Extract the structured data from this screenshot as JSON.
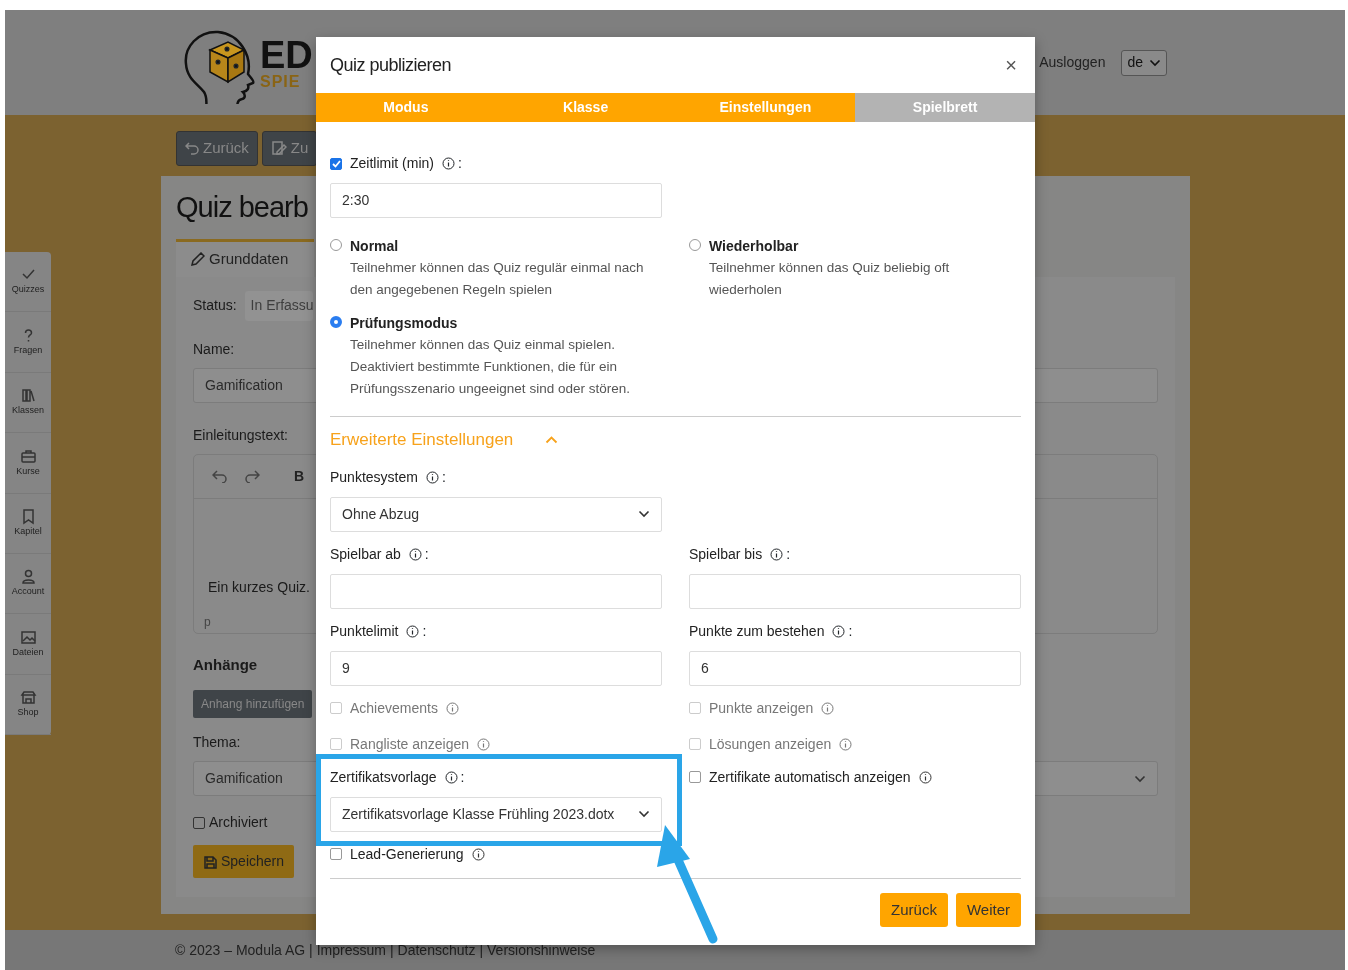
{
  "header": {
    "logo_text": "ED",
    "logo_subtext": "SPIE",
    "links": [
      "Ausloggen"
    ],
    "language": "de"
  },
  "sidebar": {
    "items": [
      {
        "label": "Quizzes"
      },
      {
        "label": "Fragen"
      },
      {
        "label": "Klassen"
      },
      {
        "label": "Kurse"
      },
      {
        "label": "Kapitel"
      },
      {
        "label": "Account"
      },
      {
        "label": "Dateien"
      },
      {
        "label": "Shop"
      }
    ]
  },
  "toolbar": [
    {
      "label": "Zurück"
    },
    {
      "label": "Zu"
    }
  ],
  "page": {
    "title": "Quiz bearb",
    "tab": "Grunddaten",
    "status_label": "Status:",
    "status_value": "In Erfassu",
    "name_label": "Name:",
    "name_value": "Gamification",
    "intro_label": "Einleitungstext:",
    "editor_bold": "B",
    "editor_text": "Ein kurzes Quiz.",
    "editor_path": "p",
    "attachments_heading": "Anhänge",
    "attach_button": "Anhang hinzufügen",
    "theme_label": "Thema:",
    "theme_value": "Gamification",
    "archived": {
      "label": "Archiviert",
      "checked": false
    },
    "save_button": "Speichern"
  },
  "footer": {
    "copyright": "© 2023 – Modula AG |",
    "separator": "|",
    "links": [
      "Impressum",
      "Datenschutz",
      "Versionshinweise"
    ]
  },
  "modal": {
    "title": "Quiz publizieren",
    "close": "×",
    "steps": [
      {
        "label": "Modus",
        "completed": true
      },
      {
        "label": "Klasse",
        "completed": true
      },
      {
        "label": "Einstellungen",
        "completed": true
      },
      {
        "label": "Spielbrett",
        "completed": false
      }
    ],
    "time_limit": {
      "label": "Zeitlimit (min)",
      "suffix": ":",
      "checked": true,
      "value": "2:30"
    },
    "modes": [
      {
        "label": "Normal",
        "description": "Teilnehmer können das Quiz regulär einmal nach den angegebenen Regeln spielen",
        "selected": false
      },
      {
        "label": "Wiederholbar",
        "description": "Teilnehmer können das Quiz beliebig oft wiederholen",
        "selected": false
      },
      {
        "label": "Prüfungsmodus",
        "description": "Teilnehmer können das Quiz einmal spielen. Deaktiviert bestimmte Funktionen, die für ein Prüfungsszenario ungeeignet sind oder stören.",
        "selected": true
      }
    ],
    "advanced": {
      "label": "Erweiterte Einstellungen",
      "expanded": true
    },
    "rows": [
      [
        {
          "kind": "select",
          "label": "Punktesystem",
          "suffix": ":",
          "value": "Ohne Abzug"
        }
      ],
      [
        {
          "kind": "input",
          "label": "Spielbar ab",
          "suffix": ":"
        },
        {
          "kind": "input",
          "label": "Spielbar bis",
          "suffix": ":"
        }
      ],
      [
        {
          "kind": "input",
          "label": "Punktelimit",
          "suffix": ":",
          "value": "9"
        },
        {
          "kind": "input",
          "label": "Punkte zum bestehen",
          "suffix": ":",
          "value": "6"
        }
      ],
      [
        {
          "kind": "checkbox",
          "label": "Achievements",
          "checked": false,
          "disabled": true
        },
        {
          "kind": "checkbox",
          "label": "Punkte anzeigen",
          "checked": false,
          "disabled": true
        }
      ],
      [
        {
          "kind": "checkbox",
          "label": "Rangliste anzeigen",
          "checked": false,
          "disabled": true
        },
        {
          "kind": "checkbox",
          "label": "Lösungen anzeigen",
          "checked": false,
          "disabled": true
        }
      ],
      [
        {
          "kind": "select",
          "label": "Zertifikatsvorlage",
          "suffix": ":",
          "value": "Zertifikatsvorlage Klasse Frühling 2023.dotx"
        },
        {
          "kind": "checkbox",
          "label": "Zertifikate automatisch anzeigen",
          "checked": false,
          "disabled": false
        }
      ],
      [
        {
          "kind": "checkbox",
          "label": "Lead-Generierung",
          "checked": false,
          "disabled": false
        }
      ]
    ],
    "buttons": [
      {
        "label": "Zurück"
      },
      {
        "label": "Weiter"
      }
    ]
  }
}
